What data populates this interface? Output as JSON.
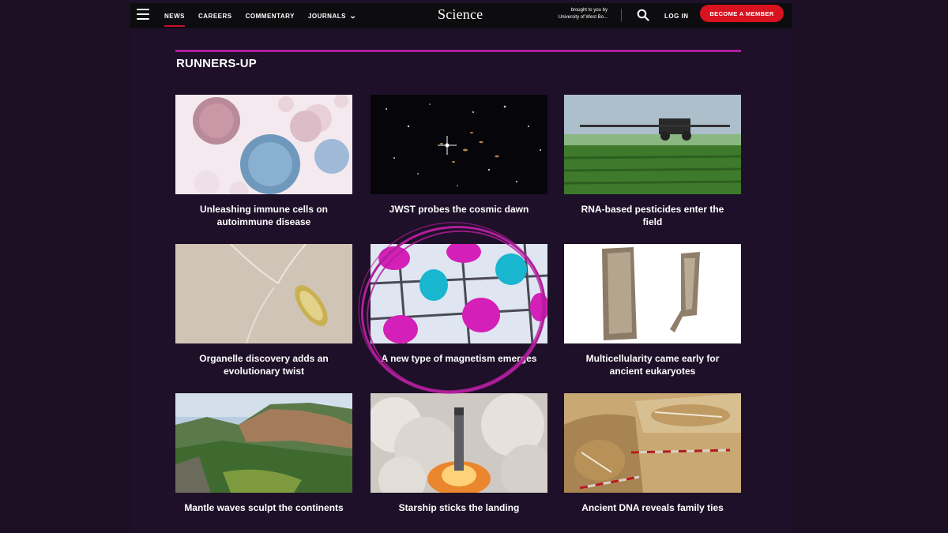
{
  "nav": {
    "links": [
      "NEWS",
      "CAREERS",
      "COMMENTARY",
      "JOURNALS"
    ],
    "logo": "Science",
    "brought_line1": "brought to you by",
    "brought_line2": "University of West Bo...",
    "login": "LOG IN",
    "member": "BECOME A MEMBER",
    "accent": "#d8121f"
  },
  "section": {
    "title": "RUNNERS-UP",
    "rule_color": "#b01e9b"
  },
  "cards": [
    {
      "caption": "Unleashing immune cells on autoimmune disease",
      "image": "immune-cells-illustration"
    },
    {
      "caption": "JWST probes the cosmic dawn",
      "image": "deep-field-galaxies"
    },
    {
      "caption": "RNA-based pesticides enter the field",
      "image": "crop-sprayer-field"
    },
    {
      "caption": "Organelle discovery adds an evolutionary twist",
      "image": "microorganism-micrograph"
    },
    {
      "caption": "A new type of magnetism emerges",
      "image": "magnetic-lattice-orbitals"
    },
    {
      "caption": "Multicellularity came early for ancient eukaryotes",
      "image": "fossil-specimens"
    },
    {
      "caption": "Mantle waves sculpt the continents",
      "image": "canyon-landscape"
    },
    {
      "caption": "Starship sticks the landing",
      "image": "rocket-landing-smoke"
    },
    {
      "caption": "Ancient DNA reveals family ties",
      "image": "burial-excavation"
    }
  ]
}
